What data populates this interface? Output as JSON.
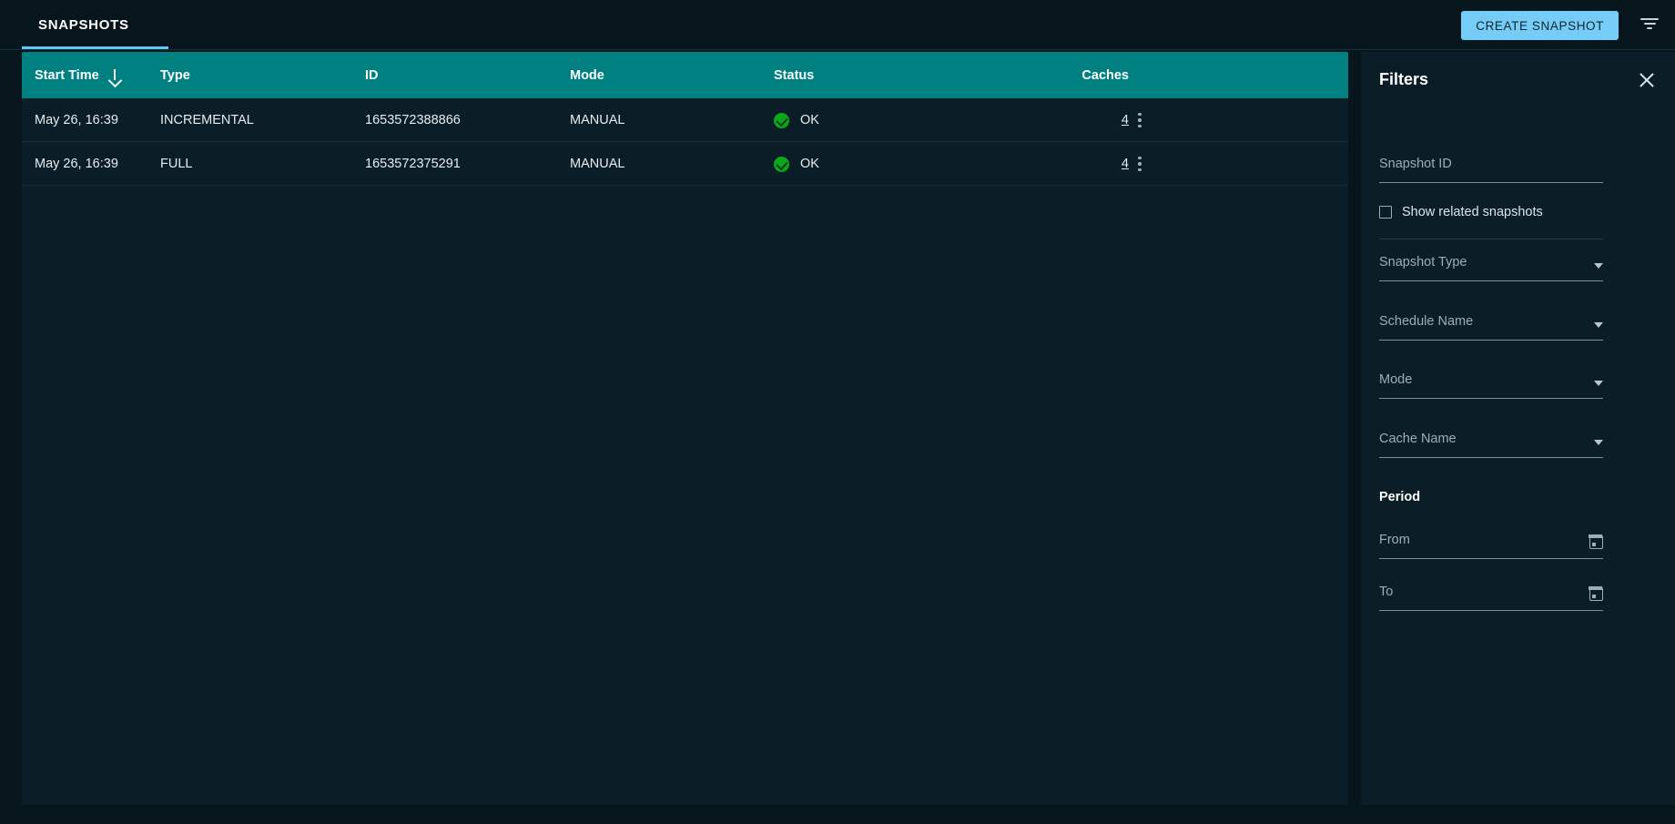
{
  "topbar": {
    "tabs": [
      {
        "label": "SNAPSHOTS",
        "active": true
      }
    ],
    "create_button_label": "CREATE SNAPSHOT",
    "filter_icon": "filter-funnel-icon",
    "accent_blue": "#74ccf7"
  },
  "table": {
    "header_bg": "#008080",
    "columns": [
      {
        "key": "start_time",
        "label": "Start Time",
        "sorted": true,
        "sort_dir": "desc",
        "sort_icon": "arrow-down-icon"
      },
      {
        "key": "type",
        "label": "Type"
      },
      {
        "key": "id",
        "label": "ID"
      },
      {
        "key": "mode",
        "label": "Mode"
      },
      {
        "key": "status",
        "label": "Status"
      },
      {
        "key": "caches",
        "label": "Caches"
      }
    ],
    "rows": [
      {
        "start_time": "May 26, 16:39",
        "type": "INCREMENTAL",
        "id": "1653572388866",
        "mode": "MANUAL",
        "status": "OK",
        "status_icon": "check-circle-icon",
        "status_color": "#0aa81a",
        "caches": "4"
      },
      {
        "start_time": "May 26, 16:39",
        "type": "FULL",
        "id": "1653572375291",
        "mode": "MANUAL",
        "status": "OK",
        "status_icon": "check-circle-icon",
        "status_color": "#0aa81a",
        "caches": "4"
      }
    ],
    "row_menu_icon": "kebab-menu-icon"
  },
  "filters": {
    "title": "Filters",
    "close_icon": "close-icon",
    "snapshot_id": {
      "label": "Snapshot ID",
      "value": ""
    },
    "show_related": {
      "label": "Show related snapshots",
      "checked": false
    },
    "snapshot_type": {
      "label": "Snapshot Type",
      "value": ""
    },
    "schedule_name": {
      "label": "Schedule Name",
      "value": ""
    },
    "mode": {
      "label": "Mode",
      "value": ""
    },
    "cache_name": {
      "label": "Cache Name",
      "value": ""
    },
    "period_title": "Period",
    "from": {
      "label": "From",
      "value": "",
      "icon": "calendar-icon"
    },
    "to": {
      "label": "To",
      "value": "",
      "icon": "calendar-icon"
    }
  }
}
